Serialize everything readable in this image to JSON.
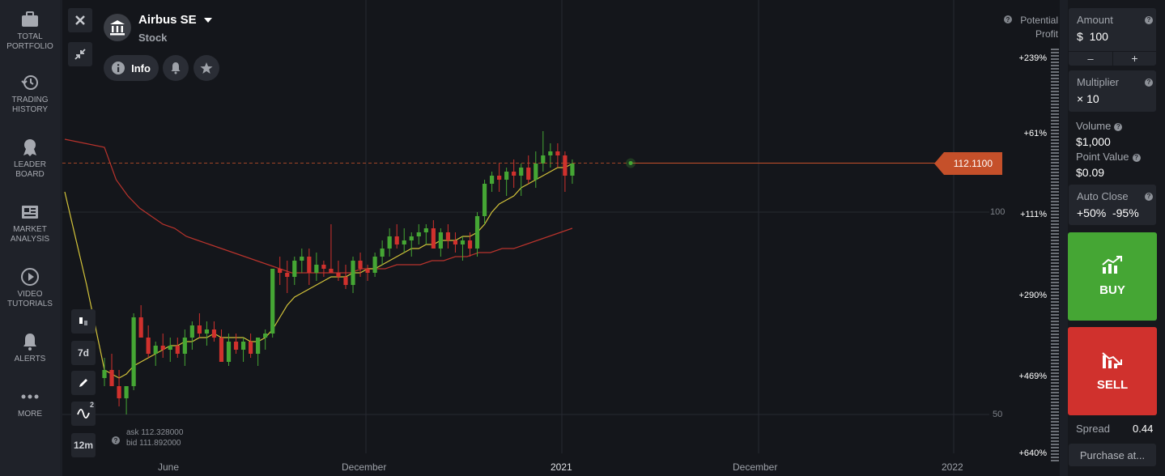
{
  "sidebar": {
    "items": [
      {
        "label": "TOTAL\nPORTFOLIO",
        "icon": "briefcase-icon"
      },
      {
        "label": "TRADING\nHISTORY",
        "icon": "history-icon"
      },
      {
        "label": "LEADER\nBOARD",
        "icon": "medal-icon"
      },
      {
        "label": "MARKET\nANALYSIS",
        "icon": "newspaper-icon"
      },
      {
        "label": "VIDEO\nTUTORIALS",
        "icon": "play-icon"
      },
      {
        "label": "ALERTS",
        "icon": "bell-icon"
      },
      {
        "label": "MORE",
        "icon": "more-dots-icon"
      }
    ]
  },
  "asset": {
    "name": "Airbus SE",
    "type": "Stock"
  },
  "toolbar": {
    "info_label": "Info",
    "close_icon": "close-icon",
    "collapse_icon": "collapse-icon"
  },
  "chart_tools": {
    "timeframe": "7d",
    "indicators_count": "2",
    "candle_size": "12m"
  },
  "quotes": {
    "ask": "ask 112.328000",
    "bid": "bid 111.892000"
  },
  "current_price": "112.1100",
  "price_axis": {
    "label_100": "100",
    "label_50": "50"
  },
  "time_axis": [
    "June",
    "December",
    "2021",
    "December",
    "2022"
  ],
  "profit_scale": {
    "title": "Potential\nProfit",
    "labels": [
      "+239%",
      "+61%",
      "+111%",
      "+290%",
      "+469%",
      "+640%"
    ]
  },
  "panel": {
    "amount_label": "Amount",
    "amount_value": "$  100",
    "minus": "–",
    "plus": "+",
    "multiplier_label": "Multiplier",
    "multiplier_value": "× 10",
    "volume_label": "Volume",
    "volume_value": "$1,000",
    "point_value_label": "Point Value",
    "point_value_value": "$0.09",
    "auto_close_label": "Auto Close",
    "auto_close_value": "+50%  -95%",
    "buy_label": "BUY",
    "sell_label": "SELL",
    "spread_label": "Spread",
    "spread_value": "0.44",
    "purchase_label": "Purchase at..."
  },
  "colors": {
    "buy": "#45a634",
    "sell": "#d0312d",
    "price_marker": "#c5502a",
    "ma_fast": "#d4c43a",
    "ma_slow": "#b8332c"
  },
  "chart_data": {
    "type": "candlestick",
    "series": [
      {
        "name": "price",
        "values": [
          [
            59,
            64,
            57,
            61
          ],
          [
            61,
            65,
            58,
            57
          ],
          [
            57,
            61,
            52,
            54
          ],
          [
            54,
            56,
            50,
            57
          ],
          [
            57,
            75,
            56,
            74
          ],
          [
            74,
            77,
            70,
            69
          ],
          [
            69,
            72,
            64,
            65
          ],
          [
            65,
            68,
            62,
            67
          ],
          [
            67,
            70,
            64,
            66
          ],
          [
            66,
            69,
            63,
            67
          ],
          [
            67,
            69,
            64,
            65
          ],
          [
            65,
            71,
            62,
            69
          ],
          [
            69,
            73,
            66,
            72
          ],
          [
            72,
            75,
            69,
            70
          ],
          [
            70,
            73,
            67,
            71
          ],
          [
            71,
            73,
            68,
            69
          ],
          [
            69,
            71,
            63,
            63
          ],
          [
            63,
            70,
            62,
            68
          ],
          [
            68,
            70,
            65,
            66
          ],
          [
            66,
            69,
            63,
            68
          ],
          [
            68,
            70,
            64,
            65
          ],
          [
            65,
            69,
            62,
            69
          ],
          [
            69,
            71,
            66,
            70
          ],
          [
            70,
            86,
            69,
            86
          ],
          [
            86,
            89,
            82,
            85
          ],
          [
            85,
            88,
            80,
            84
          ],
          [
            84,
            89,
            82,
            88
          ],
          [
            88,
            91,
            85,
            89
          ],
          [
            89,
            91,
            82,
            85
          ],
          [
            85,
            90,
            83,
            87
          ],
          [
            87,
            88,
            84,
            86
          ],
          [
            86,
            97,
            86,
            85
          ],
          [
            85,
            88,
            83,
            84
          ],
          [
            84,
            87,
            81,
            82
          ],
          [
            82,
            89,
            80,
            88
          ],
          [
            88,
            90,
            84,
            86
          ],
          [
            86,
            87,
            83,
            85
          ],
          [
            85,
            90,
            84,
            89
          ],
          [
            89,
            93,
            87,
            91
          ],
          [
            91,
            96,
            89,
            94
          ],
          [
            94,
            97,
            91,
            92
          ],
          [
            92,
            96,
            90,
            93
          ],
          [
            93,
            95,
            89,
            94
          ],
          [
            94,
            97,
            92,
            95
          ],
          [
            95,
            97,
            92,
            96
          ],
          [
            96,
            98,
            93,
            91
          ],
          [
            91,
            96,
            89,
            95
          ],
          [
            95,
            97,
            91,
            93
          ],
          [
            93,
            95,
            90,
            92
          ],
          [
            92,
            94,
            88,
            93
          ],
          [
            93,
            95,
            89,
            91
          ],
          [
            91,
            100,
            89,
            99
          ],
          [
            99,
            108,
            97,
            107
          ],
          [
            107,
            110,
            105,
            109
          ],
          [
            109,
            112,
            105,
            108
          ],
          [
            108,
            111,
            104,
            110
          ],
          [
            110,
            113,
            106,
            109
          ],
          [
            109,
            112,
            104,
            111
          ],
          [
            111,
            114,
            107,
            108
          ],
          [
            108,
            115,
            106,
            112
          ],
          [
            112,
            120,
            110,
            114
          ],
          [
            114,
            117,
            111,
            115
          ],
          [
            115,
            117,
            111,
            114
          ],
          [
            114,
            115,
            105,
            109
          ],
          [
            109,
            113,
            107,
            112
          ]
        ]
      },
      {
        "name": "MA20",
        "values": [
          61,
          60,
          59,
          60,
          62,
          63,
          64,
          65,
          66,
          67,
          67,
          68,
          68,
          69,
          69,
          70,
          69,
          69,
          69,
          69,
          68,
          68,
          69,
          71,
          74,
          77,
          79,
          80,
          81,
          82,
          83,
          84,
          84,
          84,
          85,
          85,
          86,
          86,
          87,
          88,
          89,
          90,
          91,
          91,
          92,
          92,
          93,
          93,
          93,
          94,
          94,
          95,
          97,
          100,
          102,
          103,
          104,
          106,
          107,
          108,
          109,
          110,
          111,
          111,
          112
        ]
      },
      {
        "name": "MA100",
        "values": [
          116,
          108,
          104,
          101,
          99,
          97,
          96,
          94,
          93,
          92,
          91,
          90,
          89,
          88,
          87,
          86,
          85,
          85,
          85,
          85,
          85,
          85,
          86,
          86,
          86,
          87,
          87,
          87,
          88,
          88,
          89,
          89,
          90,
          90,
          91,
          91,
          92,
          93,
          94,
          95,
          96
        ]
      }
    ],
    "ylim": [
      50,
      120
    ],
    "current_price": 112.11
  }
}
